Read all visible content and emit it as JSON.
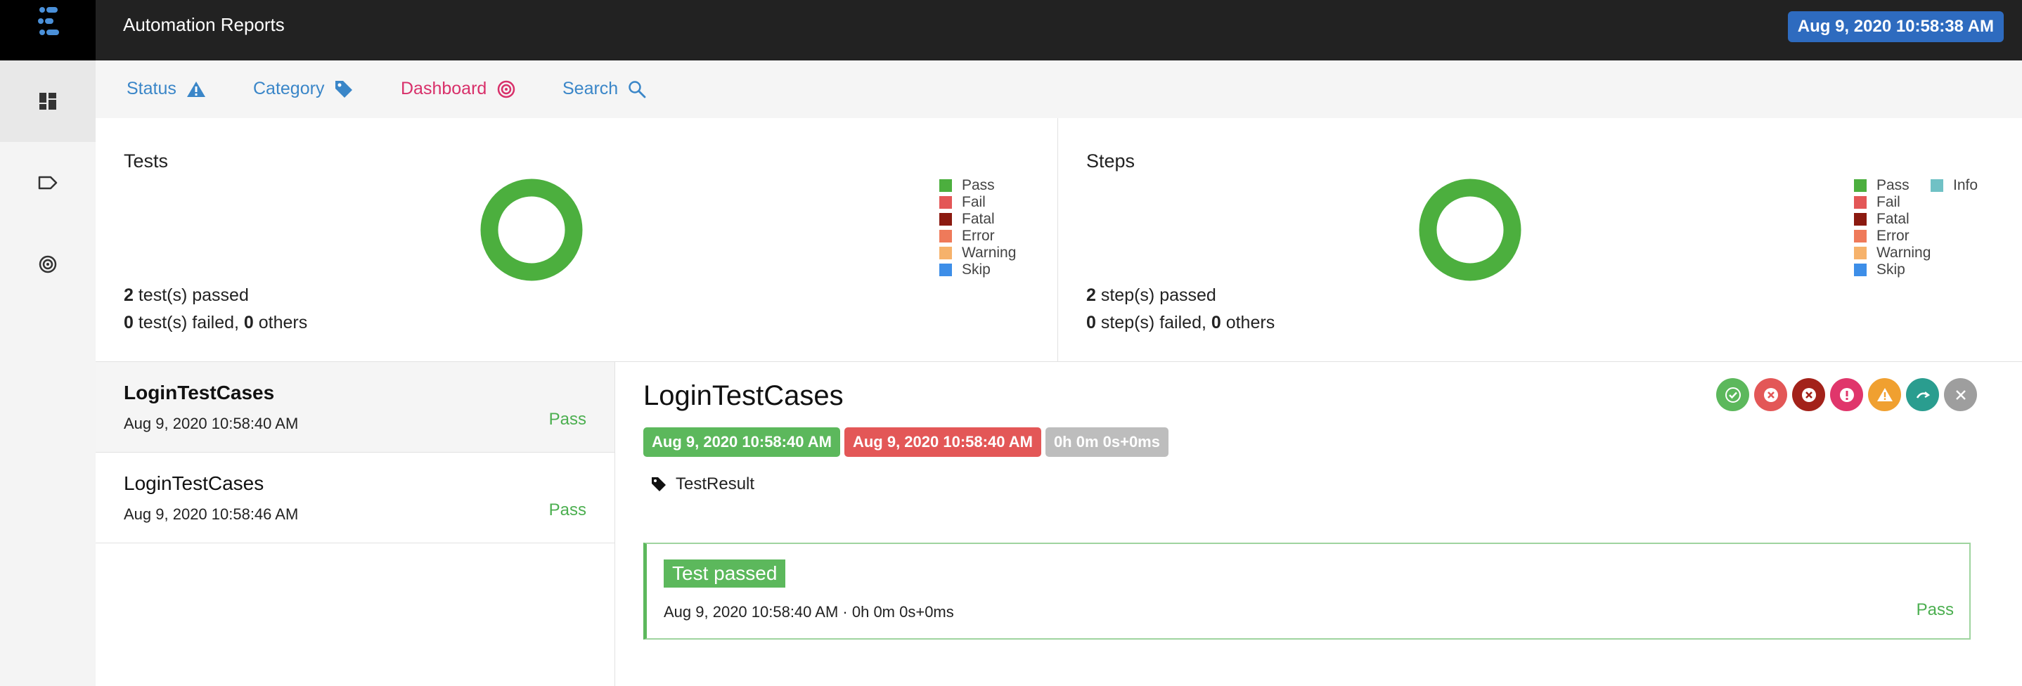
{
  "app": {
    "title": "Automation Reports",
    "timestamp": "Aug 9, 2020 10:58:38 AM"
  },
  "sidebar": {
    "items": [
      {
        "icon": "dashboard-icon",
        "active": true
      },
      {
        "icon": "tag-icon",
        "active": false
      },
      {
        "icon": "target-icon",
        "active": false
      }
    ]
  },
  "nav": {
    "status": "Status",
    "category": "Category",
    "dashboard": "Dashboard",
    "search": "Search"
  },
  "tests_card": {
    "title": "Tests",
    "legend": [
      "Pass",
      "Fail",
      "Fatal",
      "Error",
      "Warning",
      "Skip"
    ],
    "passed_count": "2",
    "passed_text": " test(s) passed",
    "failed_count": "0",
    "failed_text": " test(s) failed, ",
    "others_count": "0",
    "others_text": " others",
    "chart_data": {
      "type": "pie",
      "categories": [
        "Pass"
      ],
      "values": [
        2
      ]
    }
  },
  "steps_card": {
    "title": "Steps",
    "legend": [
      "Pass",
      "Fail",
      "Fatal",
      "Error",
      "Warning",
      "Skip"
    ],
    "legend_extra": "Info",
    "passed_count": "2",
    "passed_text": " step(s) passed",
    "failed_count": "0",
    "failed_text": " step(s) failed, ",
    "others_count": "0",
    "others_text": " others",
    "chart_data": {
      "type": "pie",
      "categories": [
        "Pass"
      ],
      "values": [
        2
      ]
    }
  },
  "legend_colors": {
    "Pass": "#4caf3e",
    "Fail": "#e35757",
    "Fatal": "#8b1a10",
    "Error": "#ef7a5a",
    "Warning": "#f6b26b",
    "Skip": "#3d8ee8",
    "Info": "#70c1c5"
  },
  "tests": [
    {
      "name": "LoginTestCases",
      "time": "Aug 9, 2020 10:58:40 AM",
      "status": "Pass"
    },
    {
      "name": "LoginTestCases",
      "time": "Aug 9, 2020 10:58:46 AM",
      "status": "Pass"
    }
  ],
  "detail": {
    "title": "LoginTestCases",
    "start": "Aug 9, 2020 10:58:40 AM",
    "end": "Aug 9, 2020 10:58:40 AM",
    "duration": "0h 0m 0s+0ms",
    "tag": "TestResult",
    "log": {
      "label": "Test passed",
      "meta": "Aug 9, 2020 10:58:40 AM · 0h 0m 0s+0ms",
      "status": "Pass"
    }
  }
}
